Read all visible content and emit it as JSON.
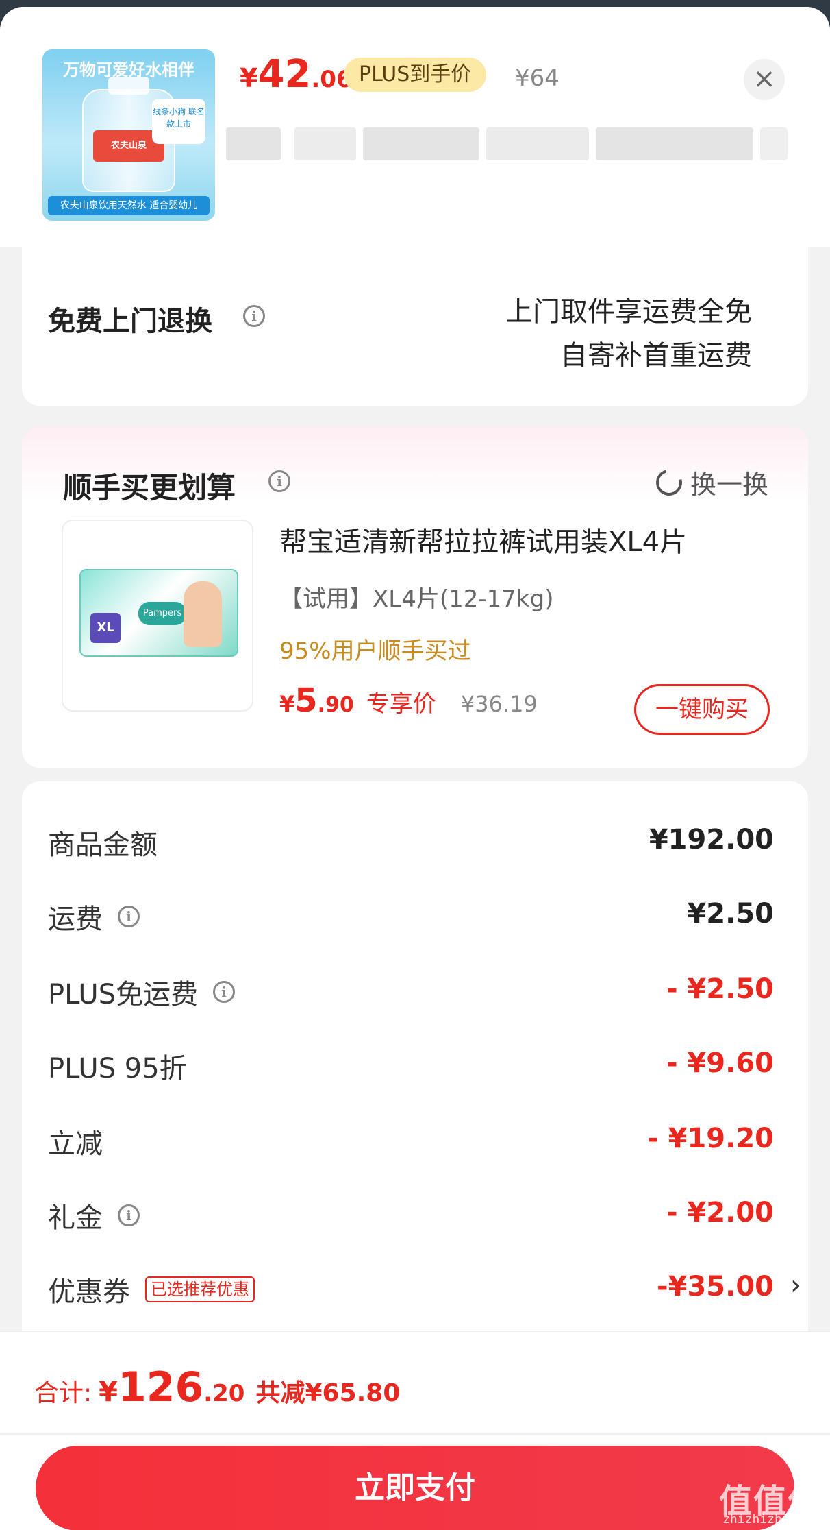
{
  "product": {
    "thumb_top_text": "万物可爱好水相伴",
    "thumb_tag": "线条小狗 联名款上市",
    "thumb_brand": "农夫山泉",
    "thumb_footer": "农夫山泉饮用天然水 适合婴幼儿",
    "price_yen": "¥",
    "price_int": "42",
    "price_dec": ".06",
    "plus_badge": "PLUS到手价",
    "orig_price": "¥64"
  },
  "close_icon": "×",
  "return_service": {
    "title": "免费上门退换",
    "line1": "上门取件享运费全免",
    "line2": "自寄补首重运费"
  },
  "bundle": {
    "title": "顺手买更划算",
    "swap_label": "换一换",
    "item": {
      "name": "帮宝适清新帮拉拉裤试用装XL4片",
      "spec": "【试用】XL4片(12-17kg)",
      "social_proof": "95%用户顺手买过",
      "price_yen": "¥",
      "price_int": "5",
      "price_dec": ".90",
      "exclusive_label": "专享价",
      "orig_price": "¥36.19",
      "buy_label": "一键购买",
      "pack_size": "XL",
      "pack_brand": "Pampers"
    }
  },
  "summary": [
    {
      "label": "商品金额",
      "value": "¥192.00",
      "red": false,
      "info": false
    },
    {
      "label": "运费",
      "value": "¥2.50",
      "red": false,
      "info": true
    },
    {
      "label": "PLUS免运费",
      "value": "- ¥2.50",
      "red": true,
      "info": true
    },
    {
      "label": "PLUS 95折",
      "value": "- ¥9.60",
      "red": true,
      "info": false
    },
    {
      "label": "立减",
      "value": "- ¥19.20",
      "red": true,
      "info": false
    },
    {
      "label": "礼金",
      "value": "- ¥2.00",
      "red": true,
      "info": true
    },
    {
      "label": "优惠券",
      "value": "-¥35.00",
      "red": true,
      "info": false,
      "tag": "已选推荐优惠"
    }
  ],
  "footer": {
    "total_label": "合计:",
    "total_yen": "¥",
    "total_int": "126",
    "total_dec": ".20",
    "total_save": "共减¥65.80",
    "pay_label": "立即支付"
  },
  "watermark": {
    "logo": "值值值",
    "url": "zhizhizhi.com"
  },
  "colors": {
    "accent_red": "#e8281f",
    "plus_gold": "#fde9a6",
    "social_orange": "#c98a1e"
  }
}
